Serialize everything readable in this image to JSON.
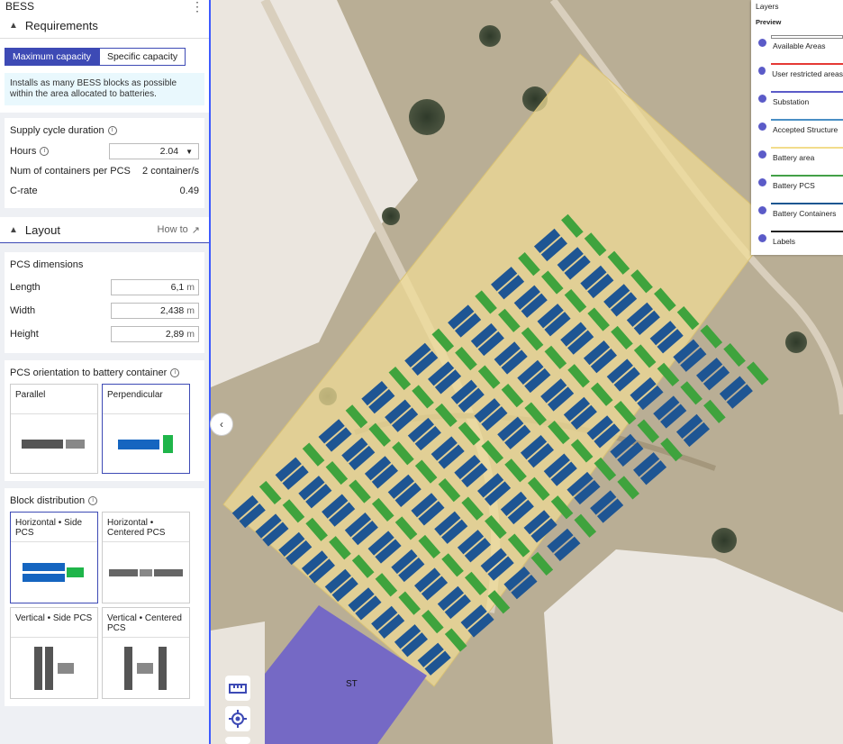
{
  "header": {
    "title": "BESS"
  },
  "requirements": {
    "title": "Requirements",
    "tabs": [
      "Maximum capacity",
      "Specific capacity"
    ],
    "info": "Installs as many BESS blocks as possible within the area allocated to batteries.",
    "supply_title": "Supply cycle duration",
    "hours_label": "Hours",
    "hours_value": "2.04",
    "containers_label": "Num of containers per PCS",
    "containers_value": "2 container/s",
    "crate_label": "C-rate",
    "crate_value": "0.49"
  },
  "layout": {
    "title": "Layout",
    "howto": "How to",
    "pcs_title": "PCS dimensions",
    "length_label": "Length",
    "length_value": "6,1",
    "length_unit": "m",
    "width_label": "Width",
    "width_value": "2,438",
    "width_unit": "m",
    "height_label": "Height",
    "height_value": "2,89",
    "height_unit": "m",
    "orient_title": "PCS orientation to battery container",
    "orient_parallel": "Parallel",
    "orient_perp": "Perpendicular",
    "block_title": "Block distribution",
    "block_hside": "Horizontal • Side PCS",
    "block_hcenter": "Horizontal • Centered PCS",
    "block_vside": "Vertical • Side PCS",
    "block_vcenter": "Vertical • Centered PCS"
  },
  "map": {
    "substation_label": "ST",
    "layers": {
      "title": "Layers",
      "preview": "Preview",
      "items": [
        {
          "name": "Available Areas",
          "color": "#ffffff"
        },
        {
          "name": "User restricted areas",
          "color": "#e53935"
        },
        {
          "name": "Substation",
          "color": "#5b5bc8"
        },
        {
          "name": "Accepted Structure",
          "color": "#4a8fc4"
        },
        {
          "name": "Battery area",
          "color": "#f2dc8c"
        },
        {
          "name": "Battery PCS",
          "color": "#43a047"
        },
        {
          "name": "Battery Containers",
          "color": "#1d5791"
        },
        {
          "name": "Labels",
          "color": "#222222"
        }
      ]
    }
  },
  "colors": {
    "accent": "#3d4ab5",
    "pcs": "#3fa33d",
    "container": "#1e5593",
    "battery_area": "#f0dc96",
    "substation": "#6f63c9"
  }
}
